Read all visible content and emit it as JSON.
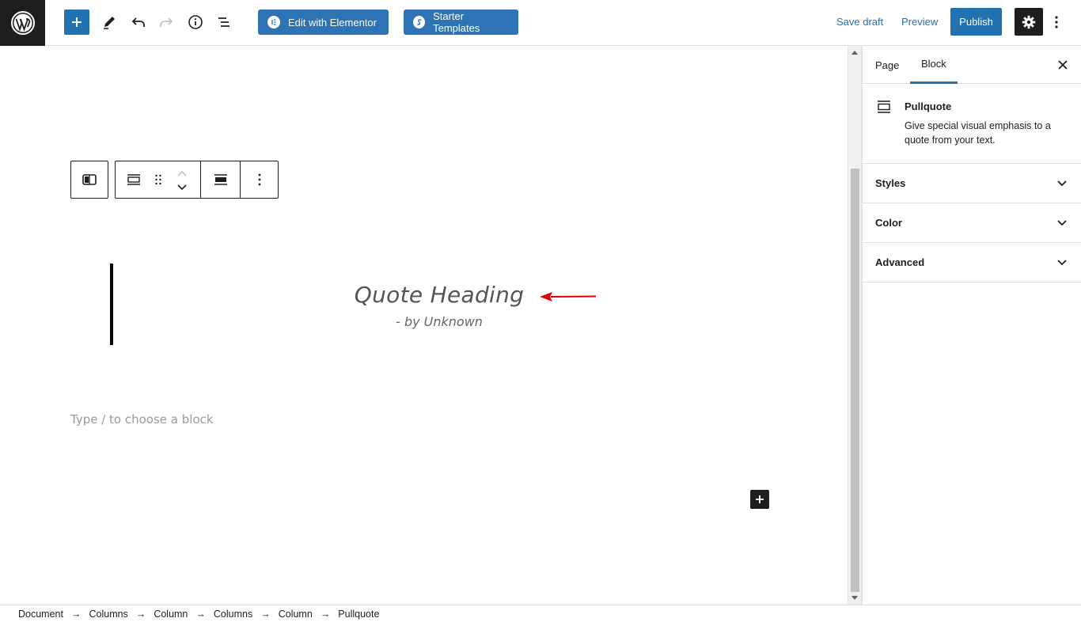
{
  "toolbar": {
    "elementor_label": "Edit with Elementor",
    "starter_label": "Starter Templates",
    "save_draft": "Save draft",
    "preview": "Preview",
    "publish": "Publish"
  },
  "block": {
    "heading": "Quote Heading",
    "citation": "- by Unknown",
    "placeholder": "Type / to choose a block"
  },
  "sidebar": {
    "tabs": [
      "Page",
      "Block"
    ],
    "active_tab": "Block",
    "block_title": "Pullquote",
    "block_description": "Give special visual emphasis to a quote from your text.",
    "panels": [
      "Styles",
      "Color",
      "Advanced"
    ]
  },
  "breadcrumbs": [
    "Document",
    "Columns",
    "Column",
    "Columns",
    "Column",
    "Pullquote"
  ],
  "colors": {
    "accent": "#2271b1",
    "dark": "#1e1e1e",
    "annotation_arrow": "#e00000"
  }
}
